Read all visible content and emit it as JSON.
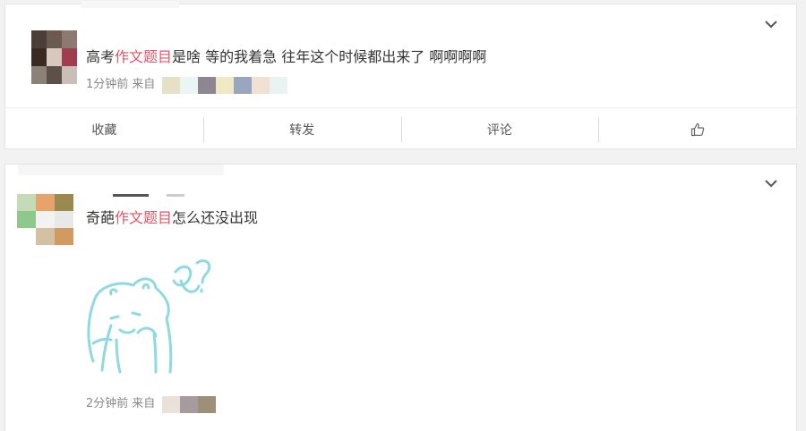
{
  "posts": [
    {
      "text_before": "高考",
      "text_highlight": "作文题目",
      "text_after": "是啥 等的我着急 往年这个时候都出来了 啊啊啊啊",
      "time": "1分钟前",
      "source_prefix": "来自",
      "avatar_colors": [
        "#4a3e37",
        "#6b5a4f",
        "#8c7a70",
        "#3a2a24",
        "#d7c9bf",
        "#9e3e4e",
        "#8a8177",
        "#5d5048",
        "#c9bfb6"
      ],
      "source_blur_colors": [
        "#e6e0c6",
        "#eaf6f4",
        "#8e8791",
        "#efe9c5",
        "#9aa6bf",
        "#f1e1d2",
        "#eaf3f2"
      ]
    },
    {
      "text_before": "奇葩",
      "text_highlight": "作文题目",
      "text_after": "怎么还没出现",
      "time": "2分钟前",
      "source_prefix": "来自",
      "avatar_colors": [
        "#c4dcb6",
        "#e6a36a",
        "#9a8a50",
        "#8ec88a",
        "#f2f2f2",
        "#e8e8e8",
        "#ffffff",
        "#d6c0a4",
        "#d09a60"
      ],
      "source_blur_colors": [
        "#eae1d9",
        "#a69b9f",
        "#9e9078"
      ]
    }
  ],
  "actions": [
    {
      "label": "收藏"
    },
    {
      "label": "转发"
    },
    {
      "label": "评论"
    },
    {
      "label": "",
      "icon": "thumbs-up-icon"
    }
  ],
  "colors": {
    "highlight": "#e0556a",
    "sketch": "#8fd9e2"
  }
}
